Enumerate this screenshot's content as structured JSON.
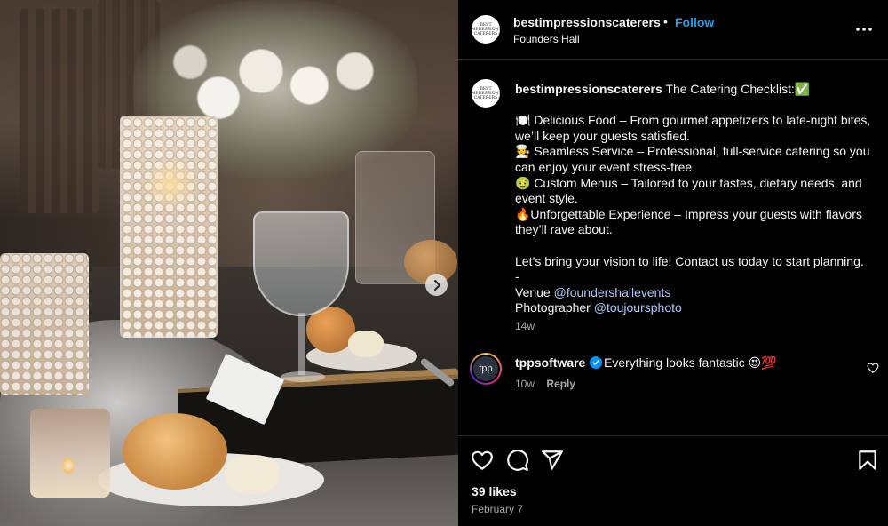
{
  "post": {
    "username": "bestimpressionscaterers",
    "separator": "•",
    "follow_label": "Follow",
    "location": "Founders Hall",
    "avatar_text": "BEST IMPRESSIONS CATERERS",
    "caption": {
      "headline": "The Catering Checklist:✅",
      "lines": [
        "🍽️ Delicious Food – From gourmet appetizers to late-night bites, we’ll keep your guests satisfied.",
        "🧑‍🍳 Seamless Service – Professional, full-service catering so you can enjoy your event stress-free.",
        "🤢 Custom Menus – Tailored to your tastes, dietary needs, and event style.",
        "🔥Unforgettable Experience – Impress your guests with flavors they’ll rave about."
      ],
      "cta": "Let’s bring your vision to life! Contact us today to start planning.",
      "dash": "-",
      "venue_label": "Venue",
      "venue_handle": "@foundershallevents",
      "photographer_label": "Photographer",
      "photographer_handle": "@toujoursphoto"
    },
    "time_ago": "14w"
  },
  "comment": {
    "avatar_text": "tpp",
    "username": "tppsoftware",
    "verified": true,
    "text": "Everything looks fantastic 😍💯",
    "time_ago": "10w",
    "reply_label": "Reply"
  },
  "footer": {
    "likes": "39 likes",
    "date": "February 7"
  },
  "icons": {
    "more": "more-horizontal-icon",
    "like": "heart-icon",
    "comment": "comment-icon",
    "share": "send-icon",
    "save": "bookmark-icon",
    "next": "chevron-right-icon",
    "verified": "verified-badge-icon"
  },
  "colors": {
    "background": "#000000",
    "text": "#f5f5f5",
    "secondary_text": "#a8a8a8",
    "follow": "#1f9bf0",
    "verified": "#0095f6",
    "divider": "#262626"
  }
}
